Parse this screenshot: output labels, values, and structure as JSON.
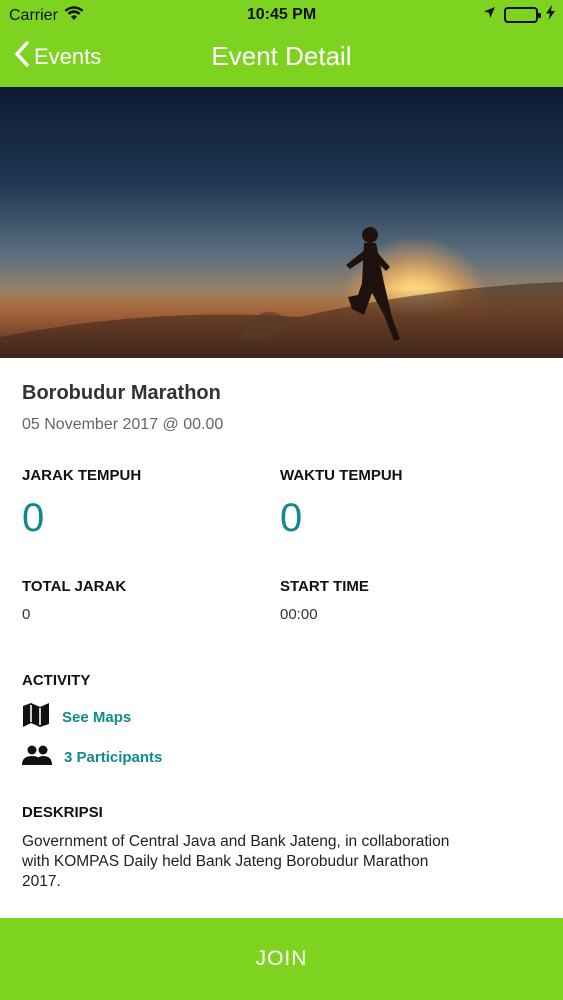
{
  "status_bar": {
    "carrier": "Carrier",
    "time": "10:45 PM"
  },
  "nav": {
    "back_label": "Events",
    "title": "Event Detail"
  },
  "event": {
    "title": "Borobudur Marathon",
    "date": "05 November 2017 @ 00.00"
  },
  "stats": {
    "jarak_label": "JARAK TEMPUH",
    "jarak_value": "0",
    "waktu_label": "WAKTU TEMPUH",
    "waktu_value": "0",
    "total_label": "TOTAL JARAK",
    "total_value": "0",
    "start_label": "START TIME",
    "start_value": "00:00"
  },
  "activity": {
    "label": "ACTIVITY",
    "maps_label": "See Maps",
    "participants_label": "3 Participants"
  },
  "description": {
    "label": "DESKRIPSI",
    "text": "Government of Central Java and Bank Jateng, in collaboration with KOMPAS Daily held Bank Jateng Borobudur Marathon 2017."
  },
  "footer": {
    "join_label": "JOIN"
  },
  "colors": {
    "accent_green": "#7ed321",
    "teal": "#138a8a"
  },
  "icons": {
    "back": "chevron-left-icon",
    "maps": "map-icon",
    "participants": "people-icon",
    "wifi": "wifi-icon",
    "location": "location-arrow-icon",
    "battery": "battery-icon",
    "charging": "charging-bolt-icon"
  }
}
